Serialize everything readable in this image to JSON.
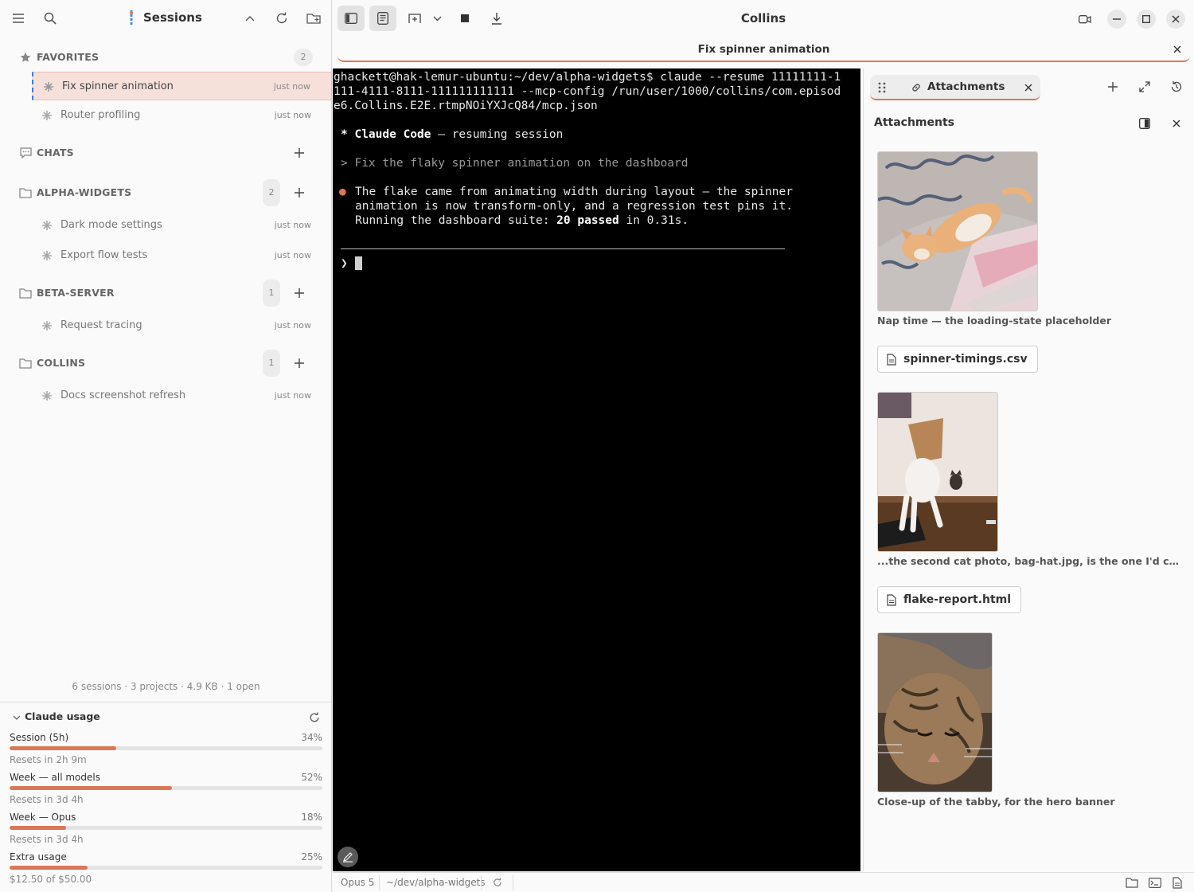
{
  "sidebar": {
    "title": "Sessions",
    "sections": {
      "favorites": {
        "label": "FAVORITES",
        "count": "2"
      },
      "chats": {
        "label": "CHATS"
      },
      "alpha": {
        "label": "ALPHA-WIDGETS",
        "count": "2"
      },
      "beta": {
        "label": "BETA-SERVER",
        "count": "1"
      },
      "collins": {
        "label": "COLLINS",
        "count": "1"
      }
    },
    "sessions": [
      {
        "name": "Fix spinner animation",
        "time": "just now"
      },
      {
        "name": "Router profiling",
        "time": "just now"
      },
      {
        "name": "Dark mode settings",
        "time": "just now"
      },
      {
        "name": "Export flow tests",
        "time": "just now"
      },
      {
        "name": "Request tracing",
        "time": "just now"
      },
      {
        "name": "Docs screenshot refresh",
        "time": "just now"
      }
    ],
    "stats": "6 sessions · 3 projects · 4.9 KB · 1 open"
  },
  "usage": {
    "title": "Claude usage",
    "meters": [
      {
        "label": "Session (5h)",
        "percent": "34%",
        "fraction": 0.34,
        "sub": "Resets in 2h 9m"
      },
      {
        "label": "Week — all models",
        "percent": "52%",
        "fraction": 0.52,
        "sub": "Resets in 3d 4h"
      },
      {
        "label": "Week — Opus",
        "percent": "18%",
        "fraction": 0.18,
        "sub": "Resets in 3d 4h"
      },
      {
        "label": "Extra usage",
        "percent": "25%",
        "fraction": 0.25,
        "sub": "$12.50 of $50.00"
      }
    ]
  },
  "window": {
    "title": "Collins"
  },
  "tab": {
    "title": "Fix spinner animation"
  },
  "terminal": {
    "cmd1": "ghackett@hak-lemur-ubuntu:~/dev/alpha-widgets$ claude --resume 11111111-1",
    "cmd2": "111-4111-8111-111111111111 --mcp-config /run/user/1000/collins/com.episod",
    "cmd3": "e6.Collins.E2E.rtmpNOiYXJcQ84/mcp.json",
    "banner_star": "*",
    "banner_name": "Claude Code",
    "banner_rest": " — resuming session",
    "prompt": "> Fix the flaky spinner animation on the dashboard",
    "bullet": "●",
    "reply1": "The flake came from animating width during layout — the spinner",
    "reply2": "animation is now transform-only, and a regression test pins it.",
    "reply3_a": "Running the dashboard suite: ",
    "reply3_b": "20 passed",
    "reply3_c": " in 0.31s.",
    "input_prompt": "❯"
  },
  "attachments": {
    "tab_label": "Attachments",
    "title": "Attachments",
    "items": [
      {
        "caption": "Nap time — the loading-state placeholder"
      },
      {
        "file": "spinner-timings.csv"
      },
      {
        "caption": "...the second cat photo, bag-hat.jpg, is the one I'd crop squa..."
      },
      {
        "file": "flake-report.html"
      },
      {
        "caption": "Close-up of the tabby, for the hero banner"
      }
    ]
  },
  "status": {
    "model": "Opus 5",
    "path": "~/dev/alpha-widgets"
  },
  "colors": {
    "accent": "#d97757",
    "active_bg": "#f6e0da",
    "terminal_bg": "#000000"
  }
}
